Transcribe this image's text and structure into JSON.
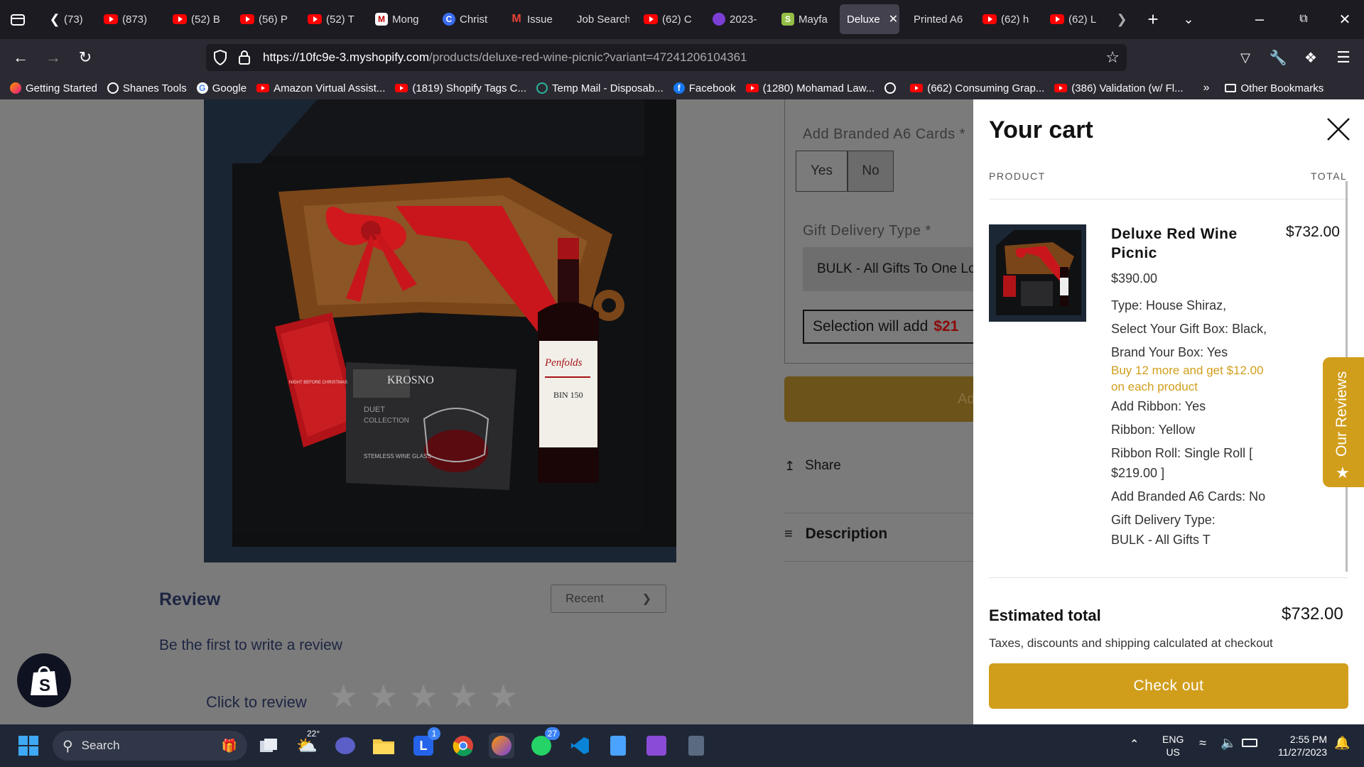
{
  "browser": {
    "tabs": [
      {
        "label": "(73)",
        "icon": "youtube-icon"
      },
      {
        "label": "(873)",
        "icon": "youtube-icon"
      },
      {
        "label": "(52) B",
        "icon": "youtube-icon"
      },
      {
        "label": "(56) P",
        "icon": "youtube-icon"
      },
      {
        "label": "(52) T",
        "icon": "youtube-icon"
      },
      {
        "label": "Mong",
        "icon": "mongo-icon"
      },
      {
        "label": "Christ",
        "icon": "canva-icon"
      },
      {
        "label": "Issue",
        "icon": "gmail-icon"
      },
      {
        "label": "Job Search",
        "icon": "none"
      },
      {
        "label": "(62) C",
        "icon": "youtube-icon"
      },
      {
        "label": "2023-",
        "icon": "app-icon"
      },
      {
        "label": "Mayfa",
        "icon": "shopify-icon"
      },
      {
        "label": "Deluxe",
        "icon": "none",
        "active": true
      },
      {
        "label": "Printed A6",
        "icon": "none"
      },
      {
        "label": "(62) h",
        "icon": "youtube-icon"
      },
      {
        "label": "(62) L",
        "icon": "youtube-icon"
      }
    ],
    "url_host": "https://10fc9e-3.myshopify.com",
    "url_path": "/products/deluxe-red-wine-picnic?variant=47241206104361",
    "bookmarks": [
      {
        "label": "Getting Started",
        "icon": "firefox-icon"
      },
      {
        "label": "Shanes Tools",
        "icon": "globe-icon"
      },
      {
        "label": "Google",
        "icon": "google-icon"
      },
      {
        "label": "Amazon Virtual Assist...",
        "icon": "youtube-icon"
      },
      {
        "label": "(1819) Shopify Tags C...",
        "icon": "youtube-icon"
      },
      {
        "label": "Temp Mail - Disposab...",
        "icon": "tempmail-icon"
      },
      {
        "label": "Facebook",
        "icon": "facebook-icon"
      },
      {
        "label": "(1280) Mohamad Law...",
        "icon": "youtube-icon"
      },
      {
        "label": "",
        "icon": "globe-icon"
      },
      {
        "label": "(662) Consuming Grap...",
        "icon": "youtube-icon"
      },
      {
        "label": "(386) Validation (w/ Fl...",
        "icon": "youtube-icon"
      }
    ],
    "other_bookmarks": "Other Bookmarks"
  },
  "product": {
    "a6_label": "Add Branded A6 Cards *",
    "a6_options": [
      "Yes",
      "No"
    ],
    "delivery_label": "Gift Delivery Type *",
    "delivery_value": "BULK - All Gifts To One Loc",
    "selection_text": "Selection will add",
    "selection_price": "$21",
    "add_button": "Ad",
    "share": "Share",
    "description": "Description",
    "review_title": "Review",
    "review_sort": "Recent",
    "review_empty": "Be the first to write a review",
    "click_to_review": "Click to review",
    "image_labels": {
      "krosno": "KROSNO",
      "duet": "DUET",
      "collection": "COLLECTION",
      "stemless": "STEMLESS WINE GLASS",
      "penfolds": "Penfolds",
      "bin": "BIN 150",
      "christmas": "NIGHT BEFORE CHRISTMAS"
    }
  },
  "cart": {
    "title": "Your cart",
    "col_product": "PRODUCT",
    "col_total": "TOTAL",
    "item_name": "Deluxe Red Wine Picnic",
    "item_price": "$390.00",
    "item_total": "$732.00",
    "properties": [
      "Type: House Shiraz,",
      "Select Your Gift Box: Black,",
      "Brand Your Box: Yes"
    ],
    "promo": "Buy 12 more and get $12.00 on each product",
    "properties2": [
      "Add Ribbon: Yes",
      "Ribbon: Yellow",
      "Ribbon Roll: Single Roll [ $219.00 ]",
      "Add Branded A6 Cards: No",
      "Gift Delivery Type:",
      "BULK - All Gifts T"
    ],
    "estimated_label": "Estimated total",
    "estimated_value": "$732.00",
    "tax_note": "Taxes, discounts and shipping calculated at checkout",
    "checkout": "Check out"
  },
  "reviews_tab": "Our Reviews",
  "taskbar": {
    "search": "Search",
    "weather": "22°",
    "lens_badge": "1",
    "whatsapp_badge": "27",
    "lang": "ENG",
    "region": "US",
    "time": "2:55 PM",
    "date": "11/27/2023"
  },
  "colors": {
    "accent": "#d19e1b",
    "promo": "#d19e1b",
    "cart_bg": "#ffffff",
    "overlay": "#7b7b7b"
  }
}
